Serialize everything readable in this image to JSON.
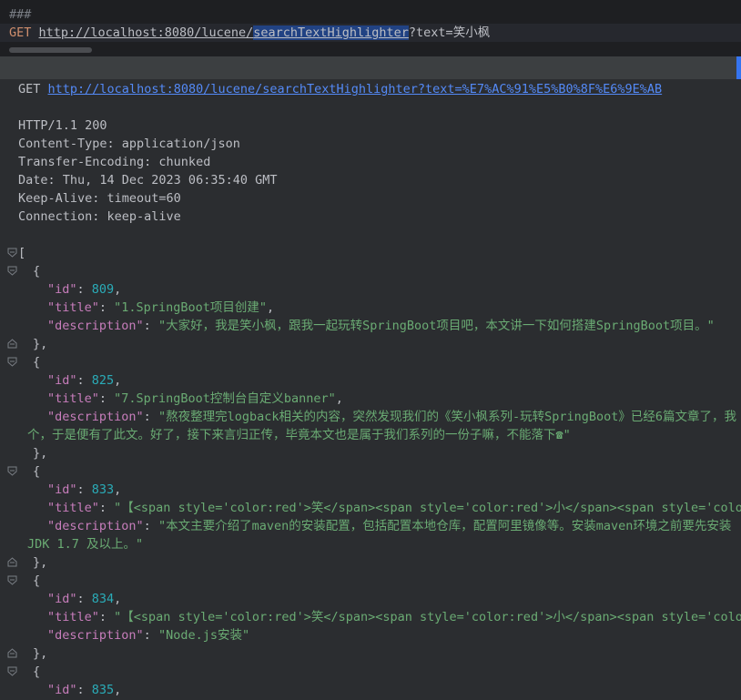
{
  "editor": {
    "comment": "###",
    "method": "GET",
    "url_prefix": "http://localhost:8080/lucene/",
    "url_selected": "searchTextHighlighter",
    "url_suffix": "?text=笑小枫"
  },
  "response": {
    "request_method": "GET",
    "request_url": "http://localhost:8080/lucene/searchTextHighlighter?text=%E7%AC%91%E5%B0%8F%E6%9E%AB",
    "headers": [
      "HTTP/1.1 200",
      "Content-Type: application/json",
      "Transfer-Encoding: chunked",
      "Date: Thu, 14 Dec 2023 06:35:40 GMT",
      "Keep-Alive: timeout=60",
      "Connection: keep-alive"
    ],
    "json": {
      "open_bracket": "[",
      "open_brace": "{",
      "close_brace": "},",
      "key_id": "\"id\"",
      "key_title": "\"title\"",
      "key_description": "\"description\"",
      "items": [
        {
          "id": "809",
          "title": "\"1.SpringBoot项目创建\"",
          "description": "\"大家好，我是笑小枫，跟我一起玩转SpringBoot项目吧，本文讲一下如何搭建SpringBoot项目。\""
        },
        {
          "id": "825",
          "title": "\"7.SpringBoot控制台自定义banner\"",
          "description": "\"熬夜整理完logback相关的内容，突然发现我们的《笑小枫系列-玩转SpringBoot》已经6篇文章了，我",
          "description_cont": "个，于是便有了此文。好了，接下来言归正传，毕竟本文也是属于我们系列的一份子嘛，不能落下☎\""
        },
        {
          "id": "833",
          "title": "\"【<span style='color:red'>笑</span><span style='color:red'>小</span><span style='color",
          "description": "\"本文主要介绍了maven的安装配置，包括配置本地仓库，配置阿里镜像等。安装maven环境之前要先安装",
          "description_cont": "JDK 1.7 及以上。\""
        },
        {
          "id": "834",
          "title": "\"【<span style='color:red'>笑</span><span style='color:red'>小</span><span style='color",
          "description": "\"Node.js安装\""
        },
        {
          "id": "835"
        }
      ]
    }
  },
  "colors": {
    "background": "#2b2d30",
    "editor_background": "#1e1f22",
    "link": "#548af7",
    "key": "#c77dbb",
    "number": "#2aacb8",
    "string": "#6aab73",
    "method": "#cf8e6d",
    "selection": "#214283"
  }
}
